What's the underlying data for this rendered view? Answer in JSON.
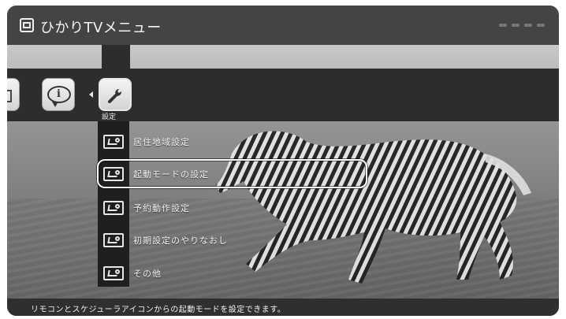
{
  "window": {
    "title": "ひかりTVメニュー",
    "title_icon": "tv-icon"
  },
  "top_nav": {
    "items": [
      {
        "name": "left-partial-icon",
        "icon": "menu-icon"
      },
      {
        "name": "info",
        "icon": "info-icon"
      },
      {
        "name": "settings",
        "icon": "wrench-icon",
        "label": "設定"
      }
    ]
  },
  "submenu": {
    "items": [
      {
        "label": "居住地域設定",
        "icon": "settings-item-icon"
      },
      {
        "label": "起動モードの設定",
        "icon": "settings-item-icon",
        "selected": true
      },
      {
        "label": "予約動作設定",
        "icon": "settings-item-icon"
      },
      {
        "label": "初期設定のやりなおし",
        "icon": "settings-item-icon"
      },
      {
        "label": "その他",
        "icon": "settings-item-icon"
      }
    ]
  },
  "status": {
    "text": "リモコンとスケジューラアイコンからの起動モードを設定できます。"
  },
  "colors": {
    "band": "#2d2d2d",
    "titlebar": "#444444",
    "highlight": "#ffffff"
  }
}
